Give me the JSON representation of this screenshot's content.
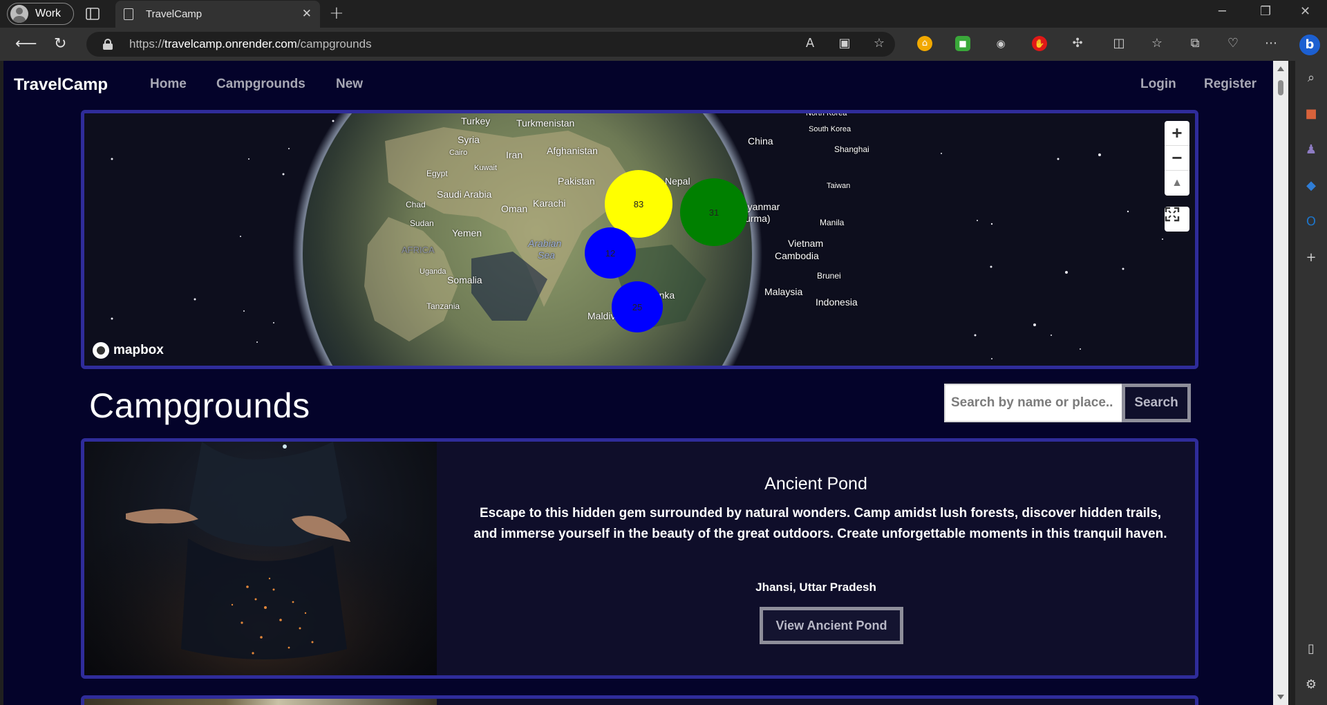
{
  "browser": {
    "profile_label": "Work",
    "tab_title": "TravelCamp",
    "url_prefix": "https://",
    "url_host": "travelcamp.onrender.com",
    "url_path": "/campgrounds"
  },
  "nav": {
    "brand": "TravelCamp",
    "links": [
      "Home",
      "Campgrounds",
      "New"
    ],
    "auth": [
      "Login",
      "Register"
    ]
  },
  "map": {
    "attribution": "mapbox",
    "clusters": [
      {
        "count": "83",
        "color": "#ffff00"
      },
      {
        "count": "31",
        "color": "#008000"
      },
      {
        "count": "12",
        "color": "#0000ff"
      },
      {
        "count": "25",
        "color": "#0000ff"
      }
    ],
    "labels": [
      "Turkey",
      "Turkmenistan",
      "Syria",
      "Cairo",
      "Iran",
      "Afghanistan",
      "Kuwait",
      "Egypt",
      "Pakistan",
      "Nepal",
      "China",
      "South Korea",
      "Shanghai",
      "Saudi Arabia",
      "Karachi",
      "Chad",
      "Oman",
      "Sudan",
      "Yemen",
      "Arabian",
      "Sea",
      "AFRICA",
      "Uganda",
      "Somalia",
      "Tanzania",
      "Sri Lanka",
      "Maldives",
      "Taiwan",
      "Myanmar",
      "(Burma)",
      "Manila",
      "Vietnam",
      "Cambodia",
      "Brunei",
      "Malaysia",
      "Indonesia",
      "North Korea"
    ]
  },
  "page": {
    "heading": "Campgrounds",
    "search_placeholder": "Search by name or place..",
    "search_button": "Search"
  },
  "campgrounds": [
    {
      "title": "Ancient Pond",
      "description": "Escape to this hidden gem surrounded by natural wonders. Camp amidst lush forests, discover hidden trails, and immerse yourself in the beauty of the great outdoors. Create unforgettable moments in this tranquil haven.",
      "location": "Jhansi, Uttar Pradesh",
      "button": "View Ancient Pond"
    }
  ]
}
